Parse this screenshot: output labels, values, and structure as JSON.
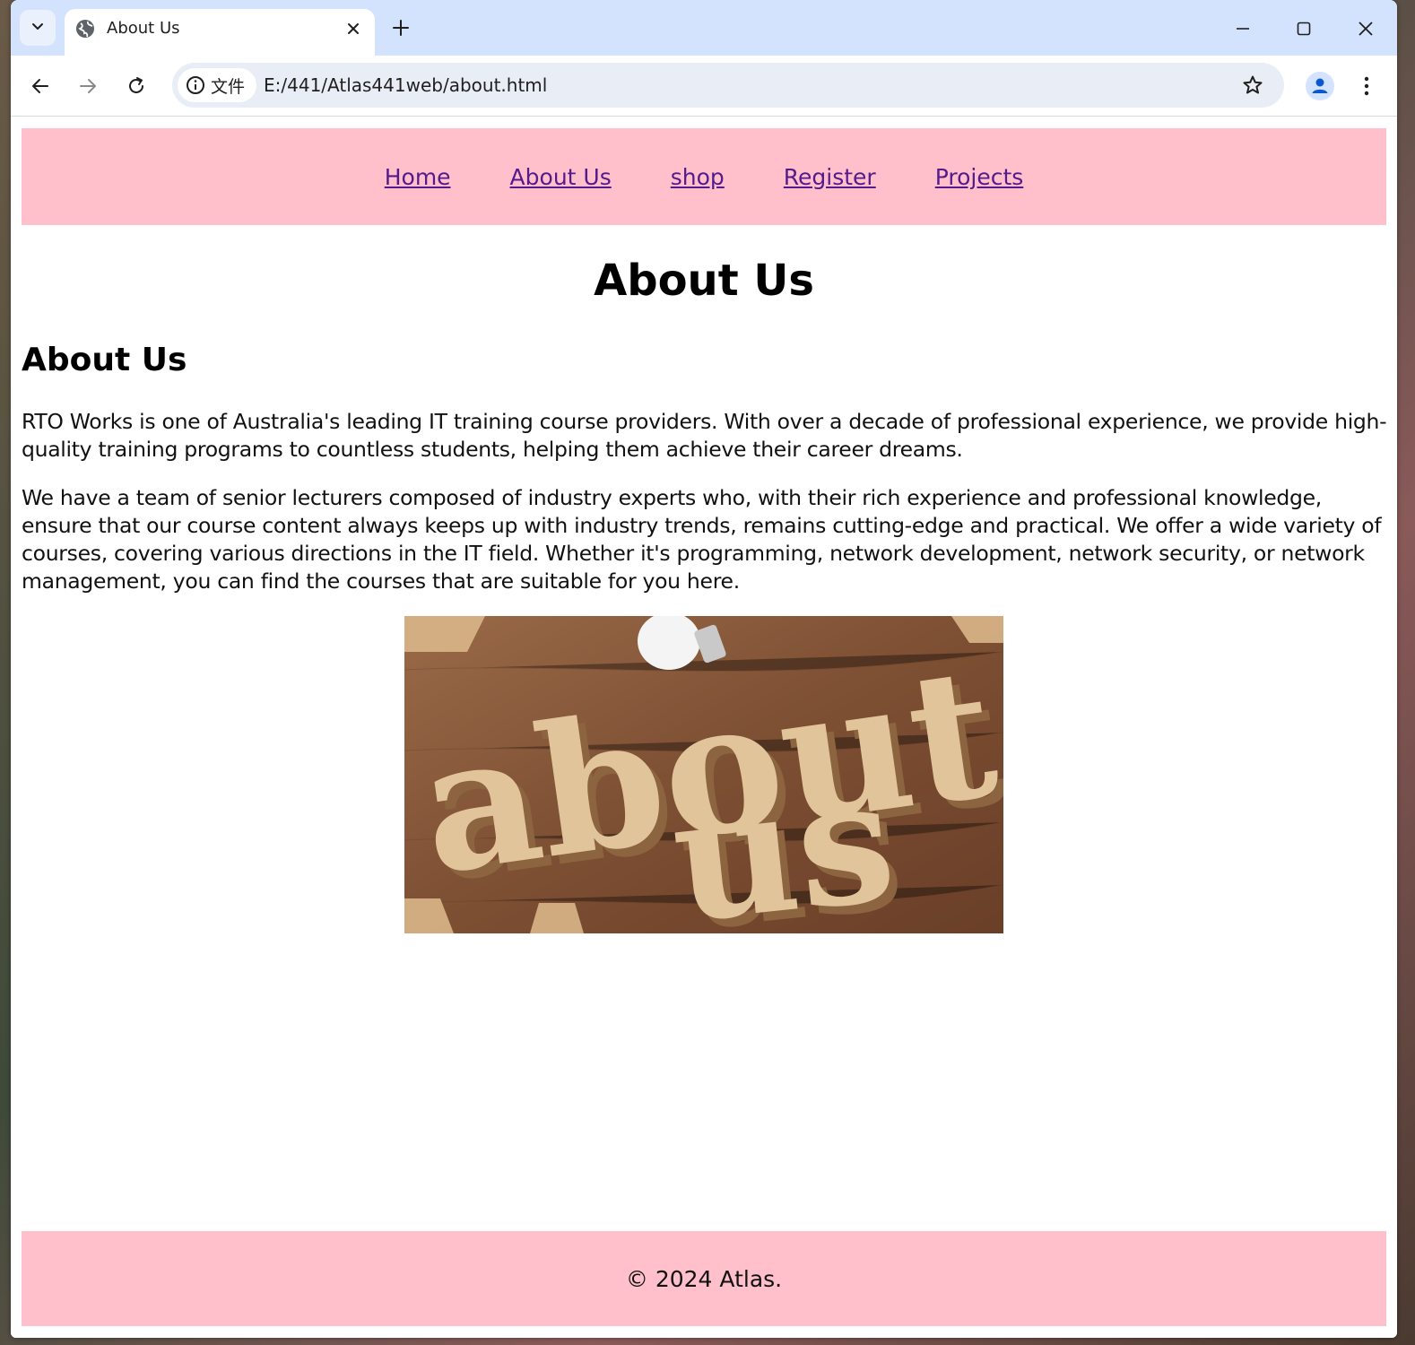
{
  "browser": {
    "tab_title": "About Us",
    "new_tab_symbol": "+",
    "site_info_label": "文件",
    "url": "E:/441/Atlas441web/about.html",
    "icons": {
      "tab_search": "chevron-down-icon",
      "favicon": "globe-icon",
      "close": "close-icon",
      "minimize": "minimize-icon",
      "maximize": "maximize-icon",
      "back": "back-arrow-icon",
      "forward": "forward-arrow-icon",
      "reload": "reload-icon",
      "info": "info-icon",
      "bookmark": "star-icon",
      "profile": "profile-icon",
      "menu": "kebab-menu-icon"
    }
  },
  "page": {
    "nav": [
      {
        "label": "Home"
      },
      {
        "label": "About Us"
      },
      {
        "label": "shop"
      },
      {
        "label": "Register"
      },
      {
        "label": "Projects"
      }
    ],
    "title": "About Us",
    "section_heading": "About Us",
    "paragraphs": [
      "RTO Works is one of Australia's leading IT training course providers. With over a decade of professional experience, we provide high-quality training programs to countless students, helping them achieve their career dreams.",
      "We have a team of senior lecturers composed of industry experts who, with their rich experience and professional knowledge, ensure that our course content always keeps up with industry trends, remains cutting-edge and practical. We offer a wide variety of courses, covering various directions in the IT field. Whether it's programming, network development, network security, or network management, you can find the courses that are suitable for you here."
    ],
    "image_text": {
      "line1": "about",
      "line2": "us"
    },
    "footer": "© 2024 Atlas."
  },
  "colors": {
    "tabstrip_bg": "#d3e3fd",
    "nav_bg": "#ffc0cb",
    "link_color": "#551a8b",
    "footer_bg": "#ffc0cb"
  }
}
